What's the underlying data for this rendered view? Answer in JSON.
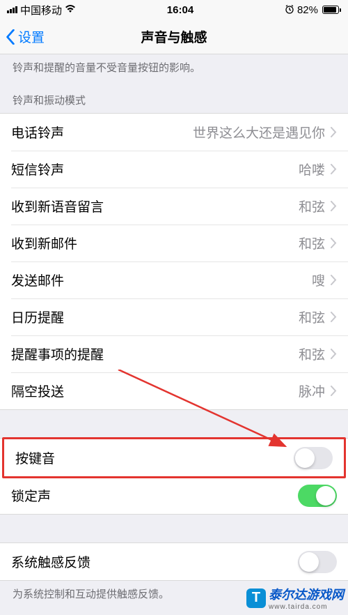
{
  "status": {
    "carrier": "中国移动",
    "time": "16:04",
    "battery_pct": "82%"
  },
  "nav": {
    "back": "设置",
    "title": "声音与触感"
  },
  "notes": {
    "volume_note": "铃声和提醒的音量不受音量按钮的影响。",
    "pattern_header": "铃声和振动模式",
    "haptic_footer": "为系统控制和互动提供触感反馈。"
  },
  "rows": {
    "ringtone": {
      "label": "电话铃声",
      "value": "世界这么大还是遇见你"
    },
    "text_tone": {
      "label": "短信铃声",
      "value": "哈喽"
    },
    "new_voicemail": {
      "label": "收到新语音留言",
      "value": "和弦"
    },
    "new_mail": {
      "label": "收到新邮件",
      "value": "和弦"
    },
    "sent_mail": {
      "label": "发送邮件",
      "value": "嗖"
    },
    "calendar": {
      "label": "日历提醒",
      "value": "和弦"
    },
    "reminders": {
      "label": "提醒事项的提醒",
      "value": "和弦"
    },
    "airdrop": {
      "label": "隔空投送",
      "value": "脉冲"
    },
    "keyboard_clicks": {
      "label": "按键音"
    },
    "lock_sound": {
      "label": "锁定声"
    },
    "system_haptics": {
      "label": "系统触感反馈"
    }
  },
  "watermark": {
    "name": "泰尔达游戏网",
    "url": "www.tairda.com"
  }
}
